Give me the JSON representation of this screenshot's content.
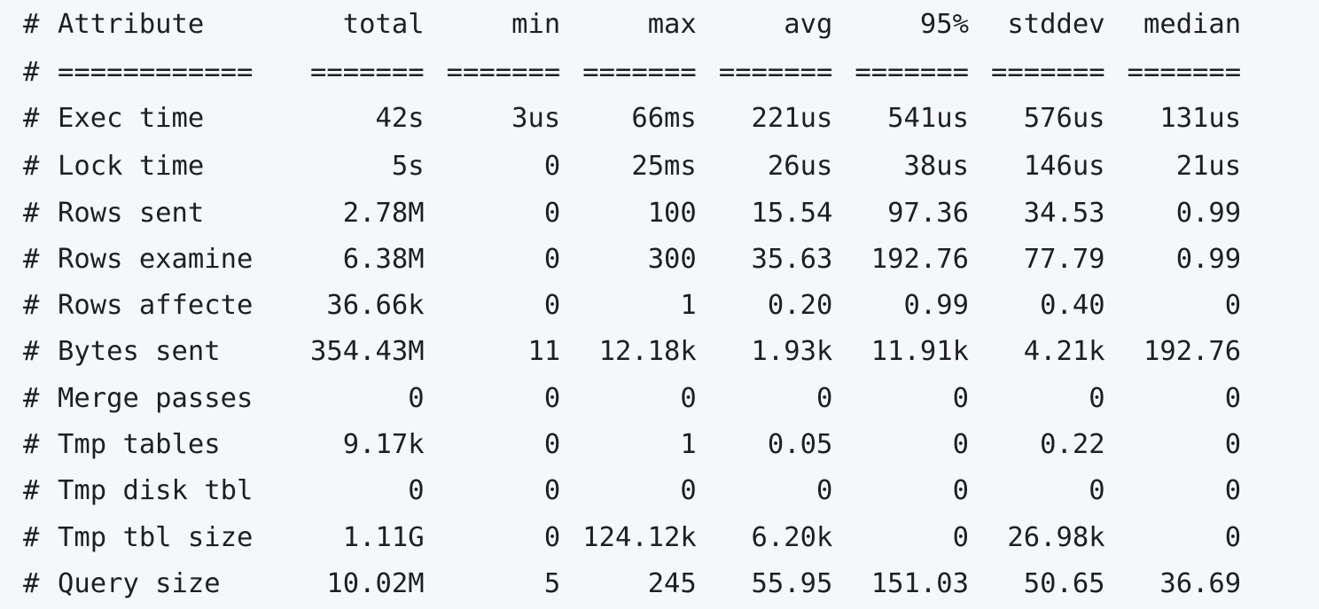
{
  "comment_marker": "#",
  "header": {
    "attribute": "Attribute",
    "columns": [
      "total",
      "min",
      "max",
      "avg",
      "95%",
      "stddev",
      "median"
    ]
  },
  "separator": {
    "attribute": "============",
    "columns": [
      "=======",
      "=======",
      "=======",
      "=======",
      "=======",
      "=======",
      "======="
    ]
  },
  "rows": [
    {
      "attribute": "Exec time",
      "values": [
        "42s",
        "3us",
        "66ms",
        "221us",
        "541us",
        "576us",
        "131us"
      ]
    },
    {
      "attribute": "Lock time",
      "values": [
        "5s",
        "0",
        "25ms",
        "26us",
        "38us",
        "146us",
        "21us"
      ]
    },
    {
      "attribute": "Rows sent",
      "values": [
        "2.78M",
        "0",
        "100",
        "15.54",
        "97.36",
        "34.53",
        "0.99"
      ]
    },
    {
      "attribute": "Rows examine",
      "values": [
        "6.38M",
        "0",
        "300",
        "35.63",
        "192.76",
        "77.79",
        "0.99"
      ]
    },
    {
      "attribute": "Rows affecte",
      "values": [
        "36.66k",
        "0",
        "1",
        "0.20",
        "0.99",
        "0.40",
        "0"
      ]
    },
    {
      "attribute": "Bytes sent",
      "values": [
        "354.43M",
        "11",
        "12.18k",
        "1.93k",
        "11.91k",
        "4.21k",
        "192.76"
      ]
    },
    {
      "attribute": "Merge passes",
      "values": [
        "0",
        "0",
        "0",
        "0",
        "0",
        "0",
        "0"
      ]
    },
    {
      "attribute": "Tmp tables",
      "values": [
        "9.17k",
        "0",
        "1",
        "0.05",
        "0",
        "0.22",
        "0"
      ]
    },
    {
      "attribute": "Tmp disk tbl",
      "values": [
        "0",
        "0",
        "0",
        "0",
        "0",
        "0",
        "0"
      ]
    },
    {
      "attribute": "Tmp tbl size",
      "values": [
        "1.11G",
        "0",
        "124.12k",
        "6.20k",
        "0",
        "26.98k",
        "0"
      ]
    },
    {
      "attribute": "Query size",
      "values": [
        "10.02M",
        "5",
        "245",
        "55.95",
        "151.03",
        "50.65",
        "36.69"
      ]
    }
  ]
}
